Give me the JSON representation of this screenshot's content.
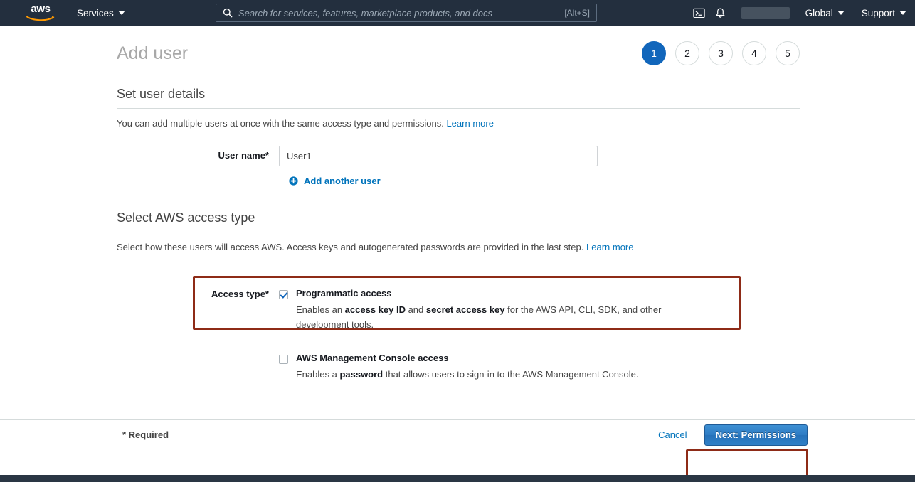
{
  "topnav": {
    "logo_text": "aws",
    "logo_name": "aws-logo",
    "services_label": "Services",
    "search": {
      "placeholder": "Search for services, features, marketplace products, and docs",
      "value": "",
      "shortcut_hint": "[Alt+S]",
      "icon": "search-icon"
    },
    "icons": [
      {
        "name": "cloudshell-icon",
        "label": ">_"
      },
      {
        "name": "notifications-bell-icon",
        "label": "bell"
      }
    ],
    "account_label": "",
    "region_label": "Global",
    "support_label": "Support",
    "background_color": "#232f3e"
  },
  "page": {
    "title": "Add user",
    "steps": [
      {
        "label": "1",
        "active": true
      },
      {
        "label": "2",
        "active": false
      },
      {
        "label": "3",
        "active": false
      },
      {
        "label": "4",
        "active": false
      },
      {
        "label": "5",
        "active": false
      }
    ],
    "active_step_color": "#1166bb"
  },
  "user_details": {
    "section_title": "Set user details",
    "description": "You can add multiple users at once with the same access type and permissions.",
    "learn_more": "Learn more",
    "username_label": "User name*",
    "username_value": "User1",
    "username_placeholder": "",
    "add_another_label": "Add another user"
  },
  "access_type": {
    "section_title": "Select AWS access type",
    "description": "Select how these users will access AWS. Access keys and autogenerated passwords are provided in the last step.",
    "learn_more": "Learn more",
    "field_label": "Access type*",
    "options": [
      {
        "name": "programmatic-access",
        "checked": true,
        "heading": "Programmatic access",
        "desc_part1": "Enables an ",
        "desc_bold1": "access key ID",
        "desc_part2": " and ",
        "desc_bold2": "secret access key",
        "desc_part3": " for the AWS API, CLI, SDK, and other development tools."
      },
      {
        "name": "console-access",
        "checked": false,
        "heading": "AWS Management Console access",
        "desc_part1": "Enables a ",
        "desc_bold1": "password",
        "desc_part2": " that allows users to sign-in to the AWS Management Console.",
        "desc_bold2": "",
        "desc_part3": ""
      }
    ],
    "annotation_color": "#8e2b17"
  },
  "footer": {
    "required_note": "* Required",
    "cancel_label": "Cancel",
    "next_label": "Next: Permissions",
    "next_button_color": "#2e7cc4",
    "annotation_color": "#8e2b17"
  }
}
